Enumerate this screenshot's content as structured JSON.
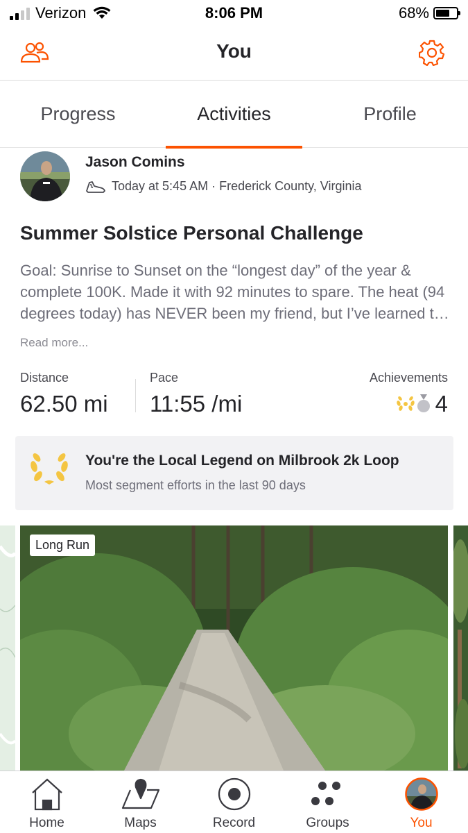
{
  "status_bar": {
    "carrier": "Verizon",
    "time": "8:06 PM",
    "battery_percent": "68%",
    "battery_level": 0.68,
    "signal_bars": 2
  },
  "header": {
    "title": "You",
    "left_icon": "friends-icon",
    "right_icon": "settings-gear-icon"
  },
  "tabs": [
    {
      "label": "Progress",
      "active": false
    },
    {
      "label": "Activities",
      "active": true
    },
    {
      "label": "Profile",
      "active": false
    }
  ],
  "activity": {
    "athlete_name": "Jason Comins",
    "meta": "Today at 5:45 AM · Frederick County, Virginia",
    "sport_icon": "shoe-icon",
    "title": "Summer Solstice Personal Challenge",
    "description": "Goal:  Sunrise to Sunset on the “longest day” of the year & complete 100K.  Made it with 92 minutes to spare.  The heat (94 degrees today) has NEVER been my friend, but I’ve learned to work with it.",
    "read_more": "Read more...",
    "stats": {
      "distance_label": "Distance",
      "distance_value": "62.50 mi",
      "pace_label": "Pace",
      "pace_value": "11:55 /mi",
      "achievements_label": "Achievements",
      "achievements_count": "4"
    },
    "legend": {
      "title": "You're the Local Legend on Milbrook 2k Loop",
      "subtitle": "Most segment efforts in the last 90 days"
    },
    "photo_badge": "Long Run"
  },
  "bottom_nav": [
    {
      "label": "Home",
      "icon": "home-icon",
      "active": false
    },
    {
      "label": "Maps",
      "icon": "maps-icon",
      "active": false
    },
    {
      "label": "Record",
      "icon": "record-icon",
      "active": false
    },
    {
      "label": "Groups",
      "icon": "groups-icon",
      "active": false
    },
    {
      "label": "You",
      "icon": "avatar-icon",
      "active": true
    }
  ],
  "colors": {
    "accent": "#fc5200",
    "text": "#242428",
    "muted": "#6d6d78",
    "gold": "#f4c542"
  }
}
